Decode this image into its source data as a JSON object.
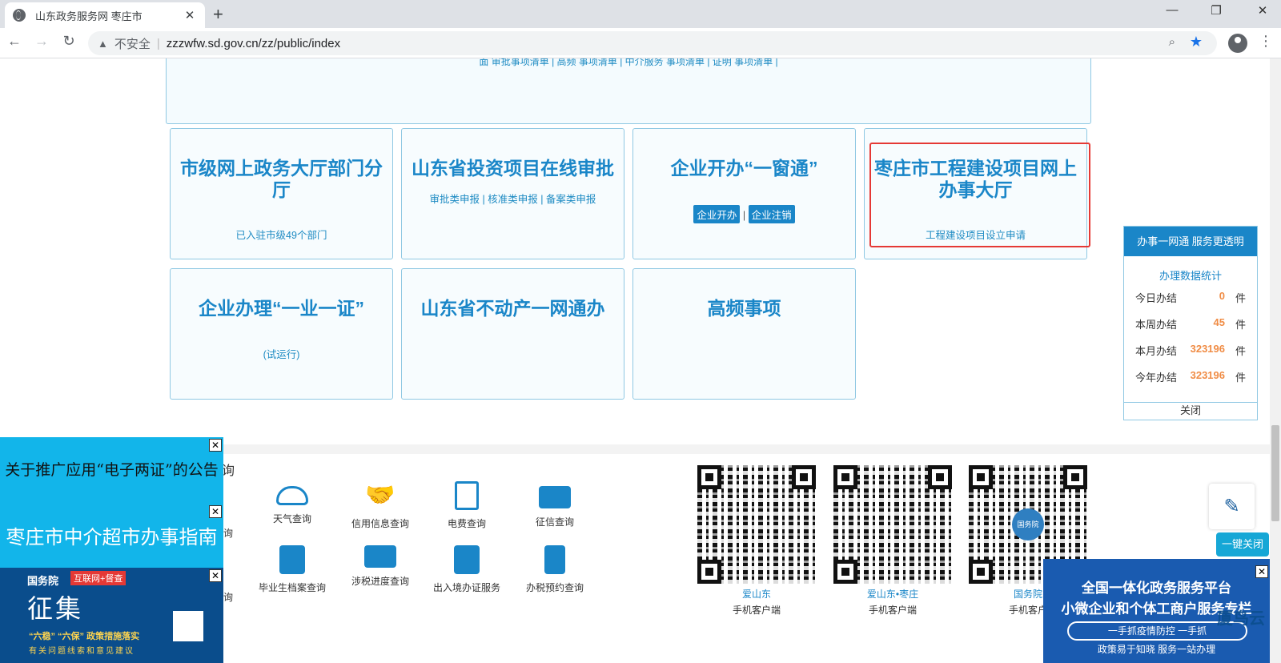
{
  "browser": {
    "tab_title": "山东政务服务网 枣庄市",
    "tab_close": "✕",
    "new_tab": "+",
    "minimize": "—",
    "maximize": "❐",
    "close": "✕",
    "back": "←",
    "forward": "→",
    "reload": "↻",
    "security_label": "不安全",
    "url": "zzzwfw.sd.gov.cn/zz/public/index"
  },
  "top_links": "面  审批事项清单 |  高频  事项清单 |  中介服务  事项清单 |  证明  事项清单 |",
  "cards": [
    {
      "title": "市级网上政务大厅部门分厅",
      "sub": "已入驻市级49个部门"
    },
    {
      "title": "山东省投资项目在线审批",
      "sub": "审批类申报  |  核准类申报  |  备案类申报"
    },
    {
      "title": "企业开办“一窗通”",
      "tag1": "企业开办",
      "tag_sep": "|",
      "tag2": "企业注销"
    },
    {
      "title": "枣庄市工程建设项目网上办事大厅",
      "sub": "工程建设项目设立申请"
    },
    {
      "title": "企业办理“一业一证”",
      "sub": "(试运行)"
    },
    {
      "title": "山东省不动产一网通办"
    },
    {
      "title": "高频事项"
    }
  ],
  "stats": {
    "header": "办事一网通  服务更透明",
    "title": "办理数据统计",
    "unit": "件",
    "rows": [
      {
        "label": "今日办结",
        "value": "0"
      },
      {
        "label": "本周办结",
        "value": "45"
      },
      {
        "label": "本月办结",
        "value": "323196"
      },
      {
        "label": "今年办结",
        "value": "323196"
      }
    ],
    "close": "关闭"
  },
  "section_heading_tail": "询",
  "services": [
    {
      "label": "询"
    },
    {
      "label": "天气查询"
    },
    {
      "label": "信用信息查询"
    },
    {
      "label": "电费查询"
    },
    {
      "label": "征信查询"
    },
    {
      "label": "询"
    },
    {
      "label": "毕业生档案查询"
    },
    {
      "label": "涉税进度查询"
    },
    {
      "label": "出入境办证服务"
    },
    {
      "label": "办税预约查询"
    }
  ],
  "apps": [
    {
      "name": "爱山东",
      "sub": "手机客户端"
    },
    {
      "name": "爱山东•枣庄",
      "sub": "手机客户端"
    },
    {
      "name": "国务院",
      "sub": "手机客户",
      "badge": "国务院"
    }
  ],
  "ads": {
    "ad1": "关于推广应用“电子两证”的公告",
    "ad2": "枣庄市中介超市办事指南",
    "ad3_org": "国务院",
    "ad3_tag": "互联网+督查",
    "ad3_big": "征集",
    "ad3_line1": "“六稳” “六保” 政策措施落实",
    "ad3_line2": "有关问题线索和意见建议",
    "close_x": "✕",
    "ad4_line1": "全国一体化政务服务平台",
    "ad4_line2": "小微企业和个体工商户服务专栏",
    "ad4_line3": "一手抓疫情防控  一手抓",
    "ad4_line4": "政策易于知晓  服务一站办理",
    "watermark": "厦鸟云"
  },
  "float": {
    "edit_icon": "✎",
    "onekey_close": "一键关闭"
  },
  "colors": {
    "accent": "#1a86c8",
    "number": "#f08c45",
    "highlight": "#e53935"
  }
}
